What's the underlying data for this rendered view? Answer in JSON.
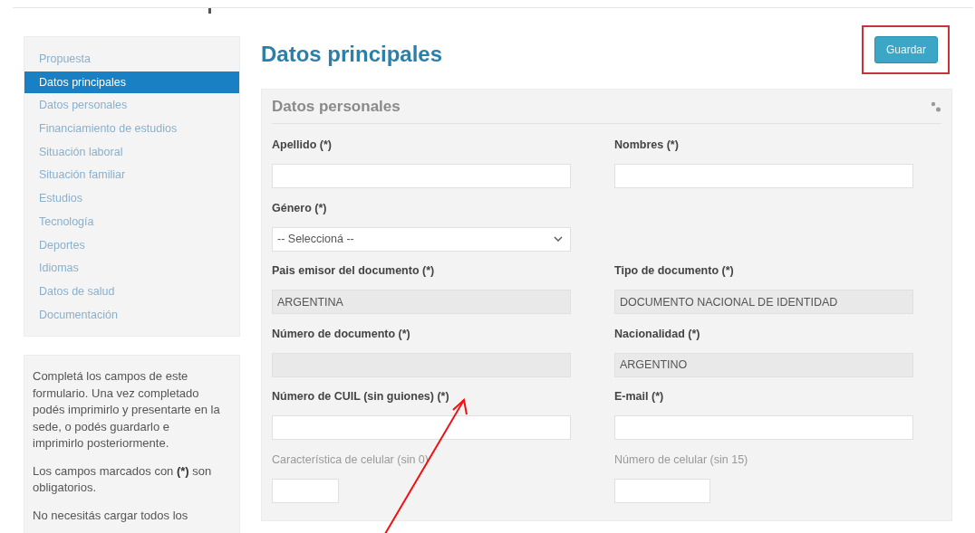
{
  "sidebar": {
    "items": [
      {
        "label": "Propuesta",
        "selected": false
      },
      {
        "label": "Datos principales",
        "selected": true
      },
      {
        "label": "Datos personales",
        "selected": false
      },
      {
        "label": "Financiamiento de estudios",
        "selected": false
      },
      {
        "label": "Situación laboral",
        "selected": false
      },
      {
        "label": "Situación familiar",
        "selected": false
      },
      {
        "label": "Estudios",
        "selected": false
      },
      {
        "label": "Tecnología",
        "selected": false
      },
      {
        "label": "Deportes",
        "selected": false
      },
      {
        "label": "Idiomas",
        "selected": false
      },
      {
        "label": "Datos de salud",
        "selected": false
      },
      {
        "label": "Documentación",
        "selected": false
      }
    ]
  },
  "help": {
    "paragraphs": [
      "Completá los campos de este formulario. Una vez completado podés imprimirlo y presentarte en la sede, o podés guardarlo e imprimirlo posteriormente.",
      "Los campos marcados con **(*)** son obligatorios.",
      "No necesitás cargar todos los"
    ]
  },
  "page": {
    "title": "Datos principales",
    "save_button": "Guardar"
  },
  "panel": {
    "title": "Datos personales",
    "fields": [
      {
        "label": "Apellido (*)",
        "kind": "text",
        "required": true
      },
      {
        "label": "Nombres (*)",
        "kind": "text",
        "required": true
      },
      {
        "label": "Género (*)",
        "kind": "select",
        "required": true,
        "value": "-- Seleccioná --"
      },
      {
        "kind": "empty"
      },
      {
        "label": "Pais emisor del documento (*)",
        "kind": "readonly",
        "required": true,
        "value": "ARGENTINA"
      },
      {
        "label": "Tipo de documento (*)",
        "kind": "readonly",
        "required": true,
        "value": "DOCUMENTO NACIONAL DE IDENTIDAD"
      },
      {
        "label": "Número de documento (*)",
        "kind": "readonly",
        "required": true
      },
      {
        "label": "Nacionalidad (*)",
        "kind": "readonly",
        "required": true,
        "value": "ARGENTINO"
      },
      {
        "label": "Número de CUIL (sin guiones) (*)",
        "kind": "text",
        "required": true
      },
      {
        "label": "E-mail (*)",
        "kind": "text",
        "required": true
      },
      {
        "label": "Característica de celular (sin 0)",
        "kind": "short",
        "required": false
      },
      {
        "label": "Número de celular (sin 15)",
        "kind": "medium",
        "required": false
      }
    ]
  }
}
